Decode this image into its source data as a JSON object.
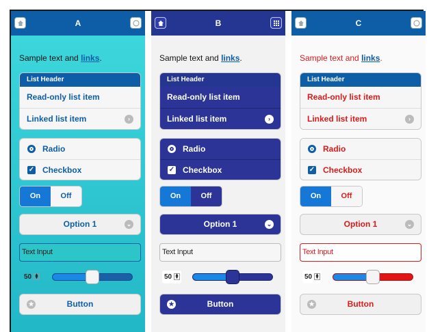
{
  "panels": [
    {
      "title": "A",
      "sample_text": "Sample text and ",
      "link_text": "links",
      "sample_end": ".",
      "list_header": "List Header",
      "read_only_item": "Read-only list item",
      "linked_item": "Linked list item",
      "radio_label": "Radio",
      "checkbox_label": "Checkbox",
      "toggle_on": "On",
      "toggle_off": "Off",
      "select_value": "Option 1",
      "text_input_value": "Text Input",
      "slider_value": "50",
      "slider_fraction": 0.5,
      "button_label": "Button"
    },
    {
      "title": "B",
      "sample_text": "Sample text and ",
      "link_text": "links",
      "sample_end": ".",
      "list_header": "List Header",
      "read_only_item": "Read-only list item",
      "linked_item": "Linked list item",
      "radio_label": "Radio",
      "checkbox_label": "Checkbox",
      "toggle_on": "On",
      "toggle_off": "Off",
      "select_value": "Option 1",
      "text_input_value": "Text Input",
      "slider_value": "50",
      "slider_fraction": 0.5,
      "button_label": "Button"
    },
    {
      "title": "C",
      "sample_text": "Sample text and ",
      "link_text": "links",
      "sample_end": ".",
      "list_header": "List Header",
      "read_only_item": "Read-only list item",
      "linked_item": "Linked list item",
      "radio_label": "Radio",
      "checkbox_label": "Checkbox",
      "toggle_on": "On",
      "toggle_off": "Off",
      "select_value": "Option 1",
      "text_input_value": "Text Input",
      "slider_value": "50",
      "slider_fraction": 0.5,
      "button_label": "Button"
    }
  ],
  "icons": {
    "header_left": "home-icon",
    "header_right": "grid-icon",
    "list_chevron": "chevron-right-icon",
    "select_chevron": "chevron-down-icon",
    "button_icon": "star-icon"
  },
  "colors": {
    "theme_a_bg": "#2cc5c8",
    "theme_b_header": "#253592",
    "theme_c_text": "#d81b1b",
    "accent_blue": "#0d5ea6"
  }
}
